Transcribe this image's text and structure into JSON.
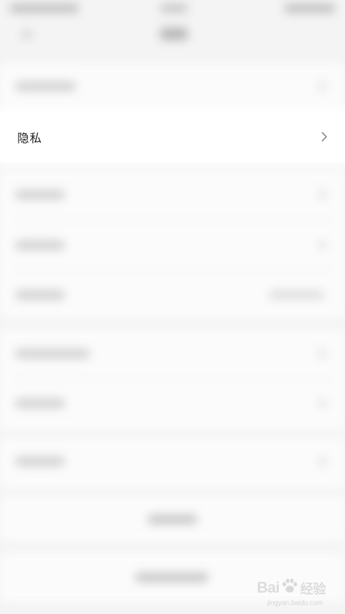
{
  "list": {
    "privacy_label": "隐私"
  },
  "watermark": {
    "brand": "Bai",
    "brand_tail": "经验",
    "domain": "jingyan.baidu.com"
  },
  "colors": {
    "background": "#f4f4f4",
    "row_background": "#ffffff",
    "text_primary": "#1f1f1f",
    "chevron": "#8a8a8a"
  }
}
